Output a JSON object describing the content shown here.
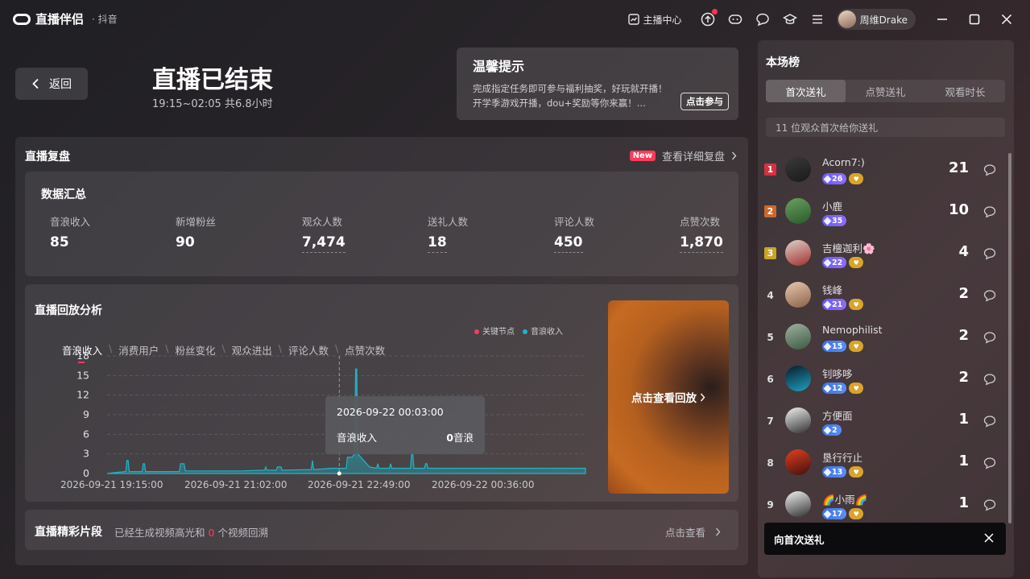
{
  "app": {
    "logo_text": "直播伴侣",
    "logo_sub": "· 抖音"
  },
  "titlebar": {
    "anchor_center": "主播中心",
    "user_name": "周维Drake"
  },
  "header": {
    "back_label": "返回",
    "title": "直播已结束",
    "time": "19:15~02:05 共6.8小时"
  },
  "tip": {
    "title": "温馨提示",
    "text": "完成指定任务即可参与福利抽奖，好玩就开播！开学季游戏开播，dou+奖励等你来赢！...",
    "button": "点击参与"
  },
  "review": {
    "title": "直播复盘",
    "new_badge": "New",
    "detail_link": "查看详细复盘"
  },
  "summary": {
    "title": "数据汇总",
    "stats": [
      {
        "label": "音浪收入",
        "value": "85"
      },
      {
        "label": "新增粉丝",
        "value": "90"
      },
      {
        "label": "观众人数",
        "value": "7,474"
      },
      {
        "label": "送礼人数",
        "value": "18"
      },
      {
        "label": "评论人数",
        "value": "450"
      },
      {
        "label": "点赞次数",
        "value": "1,870"
      }
    ]
  },
  "analysis": {
    "title": "直播回放分析",
    "legend": [
      {
        "name": "关键节点",
        "color": "#ff3b5c"
      },
      {
        "name": "音浪收入",
        "color": "#1fb5c9"
      }
    ],
    "tabs": [
      "音浪收入",
      "消费用户",
      "粉丝变化",
      "观众进出",
      "评论人数",
      "点赞次数"
    ],
    "tooltip": {
      "time": "2026-09-22 00:03:00",
      "label": "音浪收入",
      "value": "0",
      "unit": "音浪"
    },
    "replay_label": "点击查看回放"
  },
  "chart_data": {
    "type": "area",
    "y_ticks": [
      0,
      3,
      6,
      9,
      12,
      15,
      18
    ],
    "ylim": [
      0,
      18
    ],
    "x_tick_labels": [
      "2026-09-21 19:15:00",
      "2026-09-21 21:02:00",
      "2026-09-21 22:49:00",
      "2026-09-22 00:36:00"
    ],
    "xlim": [
      0,
      410
    ],
    "series": [
      {
        "color": "#1fb5c9",
        "points": [
          [
            0,
            0
          ],
          [
            10,
            0.2
          ],
          [
            16,
            0.3
          ],
          [
            17,
            2
          ],
          [
            18,
            2
          ],
          [
            19,
            0.3
          ],
          [
            30,
            0.3
          ],
          [
            31,
            1.5
          ],
          [
            32,
            1.5
          ],
          [
            33,
            0.3
          ],
          [
            62,
            0.3
          ],
          [
            63,
            1.5
          ],
          [
            66,
            1.5
          ],
          [
            67,
            0.4
          ],
          [
            95,
            0.4
          ],
          [
            115,
            0.4
          ],
          [
            135,
            0.5
          ],
          [
            136,
            1
          ],
          [
            137,
            0.5
          ],
          [
            145,
            0.5
          ],
          [
            146,
            1
          ],
          [
            148,
            1
          ],
          [
            149,
            1
          ],
          [
            150,
            0.5
          ],
          [
            175,
            0.6
          ],
          [
            176,
            2
          ],
          [
            177,
            0.6
          ],
          [
            192,
            0.8
          ],
          [
            198,
            0.8
          ],
          [
            205,
            0.8
          ],
          [
            206,
            2.5
          ],
          [
            207,
            2.5
          ],
          [
            208,
            2.5
          ],
          [
            210,
            2.5
          ],
          [
            212,
            3
          ],
          [
            213,
            16
          ],
          [
            214,
            16
          ],
          [
            215,
            3
          ],
          [
            220,
            2
          ],
          [
            225,
            1
          ],
          [
            231,
            0.8
          ],
          [
            232,
            1.5
          ],
          [
            233,
            0.8
          ],
          [
            242,
            0.8
          ],
          [
            243,
            1.5
          ],
          [
            244,
            0.8
          ],
          [
            260,
            0.8
          ],
          [
            261,
            3
          ],
          [
            262,
            3
          ],
          [
            263,
            0.8
          ],
          [
            272,
            0.8
          ],
          [
            273,
            1.5
          ],
          [
            274,
            1.5
          ],
          [
            275,
            0.8
          ],
          [
            410,
            0.8
          ]
        ]
      }
    ],
    "cursor_x": 199
  },
  "clips": {
    "title": "直播精彩片段",
    "text_before": "已经生成视频高光和",
    "count": "0",
    "text_after": "个视频回溯",
    "link": "点击查看"
  },
  "side": {
    "title": "本场榜",
    "tabs": [
      "首次送礼",
      "点赞送礼",
      "观看时长"
    ],
    "info": "11 位观众首次给你送礼",
    "rank_colors": [
      "#d93040",
      "#c9692e",
      "#c9a32a"
    ],
    "ranks": [
      {
        "rank": "1",
        "name": "Acorn7:)",
        "level": "26",
        "level_style": "purple",
        "heart": true,
        "count": "21",
        "avatar": "linear-gradient(160deg,#3a3a3a,#1a1a1a)"
      },
      {
        "rank": "2",
        "name": "小鹿",
        "level": "35",
        "level_style": "purple",
        "heart": false,
        "count": "10",
        "avatar": "linear-gradient(160deg,#6aa060,#2a5a2a)"
      },
      {
        "rank": "3",
        "name": "吉檀迦利🌸",
        "level": "22",
        "level_style": "purple",
        "heart": true,
        "count": "4",
        "avatar": "linear-gradient(160deg,#e0d0c8,#a03030)"
      },
      {
        "rank": "4",
        "name": "钱峰",
        "level": "21",
        "level_style": "purple",
        "heart": true,
        "count": "2",
        "avatar": "linear-gradient(160deg,#e8c8b0,#8a6048)"
      },
      {
        "rank": "5",
        "name": "Nemophilist",
        "level": "15",
        "level_style": "blue",
        "heart": true,
        "count": "2",
        "avatar": "linear-gradient(160deg,#a0b0a0,#3a5a40)"
      },
      {
        "rank": "6",
        "name": "钊哆哆",
        "level": "12",
        "level_style": "blue",
        "heart": true,
        "count": "2",
        "avatar": "linear-gradient(160deg,#0a1a2a,#20a0c0)"
      },
      {
        "rank": "7",
        "name": "方便面",
        "level": "2",
        "level_style": "blue",
        "heart": false,
        "count": "1",
        "avatar": "linear-gradient(160deg,#f0f0f0,#303030)"
      },
      {
        "rank": "8",
        "name": "垦行行止",
        "level": "13",
        "level_style": "blue",
        "heart": true,
        "count": "1",
        "avatar": "linear-gradient(160deg,#e04020,#401010)"
      },
      {
        "rank": "9",
        "name": "🌈小雨🌈",
        "level": "17",
        "level_style": "blue",
        "heart": true,
        "count": "1",
        "avatar": "linear-gradient(160deg,#f0f0f0,#303030)"
      }
    ],
    "toast": "向首次送礼"
  }
}
